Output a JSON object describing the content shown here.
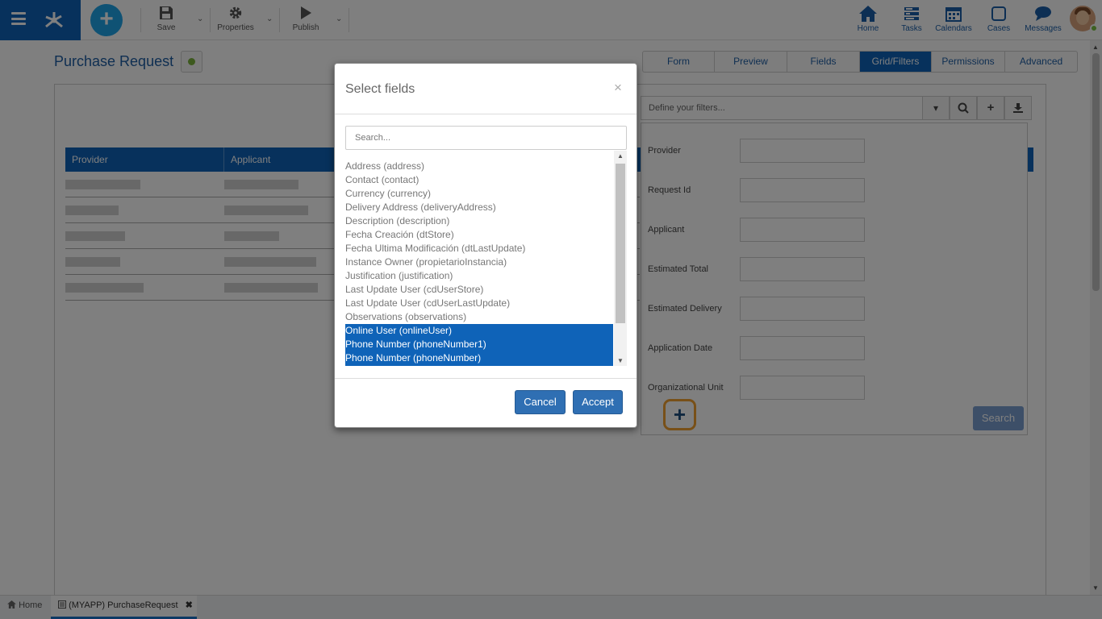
{
  "topbar": {
    "tools": [
      {
        "label": "Save",
        "icon": "save-icon"
      },
      {
        "label": "Properties",
        "icon": "gear-icon"
      },
      {
        "label": "Publish",
        "icon": "play-icon"
      }
    ],
    "nav": [
      {
        "label": "Home",
        "icon": "home-icon"
      },
      {
        "label": "Tasks",
        "icon": "tasks-icon"
      },
      {
        "label": "Calendars",
        "icon": "calendar-icon"
      },
      {
        "label": "Cases",
        "icon": "cases-icon"
      },
      {
        "label": "Messages",
        "icon": "messages-icon"
      }
    ],
    "accent": "#0f63b8"
  },
  "page": {
    "title": "Purchase Request",
    "tabs": [
      "Form",
      "Preview",
      "Fields",
      "Grid/Filters",
      "Permissions",
      "Advanced"
    ],
    "active_tab": "Grid/Filters"
  },
  "grid": {
    "columns": [
      "Provider",
      "Applicant"
    ]
  },
  "filters": {
    "placeholder": "Define your filters...",
    "fields": [
      "Provider",
      "Request Id",
      "Applicant",
      "Estimated Total",
      "Estimated Delivery",
      "Application Date",
      "Organizational Unit"
    ],
    "search_label": "Search",
    "add_symbol": "+"
  },
  "modal": {
    "title": "Select fields",
    "close": "×",
    "search_placeholder": "Search...",
    "items": [
      "Address (address)",
      "Contact (contact)",
      "Currency (currency)",
      "Delivery Address (deliveryAddress)",
      "Description (description)",
      "Fecha Creación (dtStore)",
      "Fecha Ultima Modificación (dtLastUpdate)",
      "Instance Owner (propietarioInstancia)",
      "Justification (justification)",
      "Last Update User (cdUserStore)",
      "Last Update User (cdUserLastUpdate)",
      "Observations (observations)",
      "Online User (onlineUser)",
      "Phone Number (phoneNumber1)",
      "Phone Number (phoneNumber)"
    ],
    "selected_items": [
      "Online User (onlineUser)",
      "Phone Number (phoneNumber1)",
      "Phone Number (phoneNumber)"
    ],
    "cancel_label": "Cancel",
    "accept_label": "Accept"
  },
  "bottom_tabs": [
    {
      "label": "Home"
    },
    {
      "label": "(MYAPP) PurchaseRequest",
      "close": "✖"
    }
  ]
}
